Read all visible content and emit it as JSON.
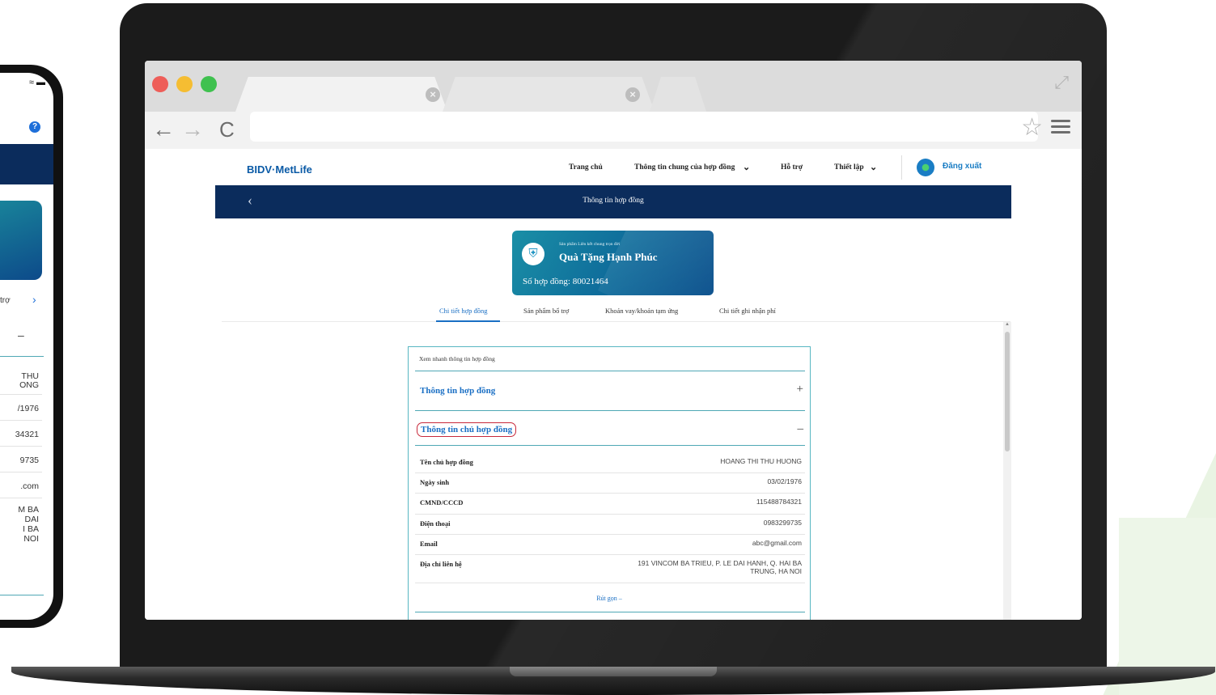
{
  "phone": {
    "status_icons": "≈ ▬",
    "help_icon": "?",
    "row_fragment_label": "trợ",
    "chevron": "›",
    "minus": "–",
    "rows": [
      "THU\nONG",
      "/1976",
      "34321",
      "9735",
      ".com",
      "M BA\nDAI\nI BA\nNOI"
    ]
  },
  "browser": {
    "url": "",
    "tab_close": "×",
    "nav_back": "←",
    "nav_forward": "→",
    "nav_reload": "C",
    "star": "☆",
    "expand": "⤢"
  },
  "site": {
    "logo": "BIDV·MetLife",
    "nav": {
      "home": "Trang chủ",
      "contract_info": "Thông tin chung của hợp đồng",
      "support": "Hỗ trợ",
      "settings": "Thiết lập",
      "logout": "Đăng xuất"
    },
    "page_title": "Thông tin hợp đồng",
    "back_icon": "‹"
  },
  "product": {
    "subtitle": "Sản phẩm Liên kết chung trọn đời",
    "name": "Quà Tặng Hạnh Phúc",
    "contract_number": "Số hợp đồng: 80021464"
  },
  "subtabs": [
    "Chi tiết hợp đồng",
    "Sản phẩm bổ trợ",
    "Khoản vay/khoản tạm ứng",
    "Chi tiết ghi nhận phí"
  ],
  "panel": {
    "header": "Xem nhanh thông tin hợp đồng",
    "contract_section": "Thông tin hợp đồng",
    "contract_toggle": "+",
    "owner_section": "Thông tin chủ hợp đồng",
    "owner_toggle": "–",
    "rows": [
      {
        "label": "Tên chủ hợp đồng",
        "value": "HOANG THI THU HUONG"
      },
      {
        "label": "Ngày sinh",
        "value": "03/02/1976"
      },
      {
        "label": "CMND/CCCD",
        "value": "115488784321"
      },
      {
        "label": "Điện thoại",
        "value": "0983299735"
      },
      {
        "label": "Email",
        "value": "abc@gmail.com"
      },
      {
        "label": "Địa chỉ liên hệ",
        "value": "191 VINCOM BA TRIEU, P. LE DAI HANH, Q. HAI BA\nTRUNG, HA NOI"
      }
    ],
    "collapse": "Rút gọn  –"
  }
}
